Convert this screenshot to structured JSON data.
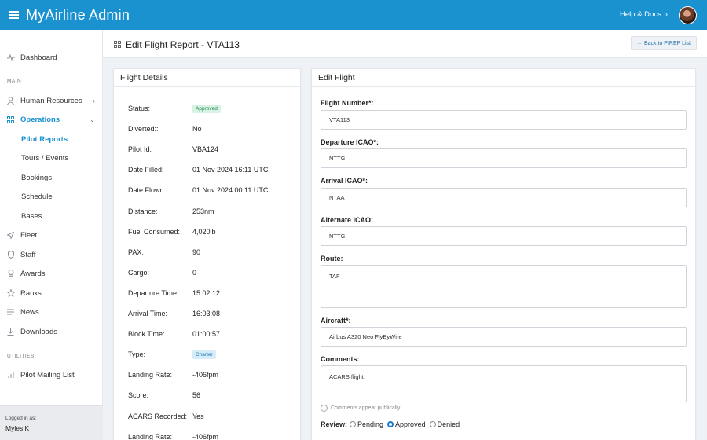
{
  "topbar": {
    "brand": "MyAirline Admin",
    "help_label": "Help & Docs",
    "help_chevron": "›",
    "accent": "#1b92d0"
  },
  "sidebar": {
    "dashboard": {
      "label": "Dashboard",
      "icon": "activity-icon"
    },
    "section_main": "MAIN",
    "section_utilities": "UTILITIES",
    "items": [
      {
        "label": "Human Resources",
        "icon": "person-icon",
        "chevron": "›"
      },
      {
        "label": "Operations",
        "icon": "grid-icon",
        "chevron": "⌄"
      },
      {
        "label": "Fleet",
        "icon": "plane-icon"
      },
      {
        "label": "Staff",
        "icon": "shield-icon"
      },
      {
        "label": "Awards",
        "icon": "award-icon"
      },
      {
        "label": "Ranks",
        "icon": "star-icon"
      },
      {
        "label": "News",
        "icon": "list-icon"
      },
      {
        "label": "Downloads",
        "icon": "download-icon"
      }
    ],
    "operations_sub": [
      {
        "label": "Pilot Reports"
      },
      {
        "label": "Tours / Events"
      },
      {
        "label": "Bookings"
      },
      {
        "label": "Schedule"
      },
      {
        "label": "Bases"
      }
    ],
    "utilities": [
      {
        "label": "Pilot Mailing List",
        "icon": "bars-icon"
      }
    ],
    "logged_in_label": "Logged in as:",
    "logged_in_user": "Myles K"
  },
  "page": {
    "title": "Edit Flight Report - VTA113",
    "back_label": "← Back to PIREP List"
  },
  "details": {
    "title": "Flight Details",
    "rows": [
      {
        "key": "Status:",
        "value": "Approved",
        "badge": "green"
      },
      {
        "key": "Diverted::",
        "value": "No"
      },
      {
        "key": "Pilot Id:",
        "value": "VBA124"
      },
      {
        "key": "Date Filled:",
        "value": "01 Nov 2024 16:11 UTC"
      },
      {
        "key": "Date Flown:",
        "value": "01 Nov 2024 00:11 UTC"
      },
      {
        "key": "Distance:",
        "value": "253nm"
      },
      {
        "key": "Fuel Consumed:",
        "value": "4,020lb"
      },
      {
        "key": "PAX:",
        "value": "90"
      },
      {
        "key": "Cargo:",
        "value": "0"
      },
      {
        "key": "Departure Time:",
        "value": "15:02:12"
      },
      {
        "key": "Arrival Time:",
        "value": "16:03:08"
      },
      {
        "key": "Block Time:",
        "value": "01:00:57"
      },
      {
        "key": "Type:",
        "value": "Charter",
        "badge": "blue"
      },
      {
        "key": "Landing Rate:",
        "value": "-406fpm"
      },
      {
        "key": "Score:",
        "value": "56"
      },
      {
        "key": "ACARS Recorded:",
        "value": "Yes"
      },
      {
        "key": "Landing Rate:",
        "value": "-406fpm"
      }
    ]
  },
  "edit": {
    "title": "Edit Flight",
    "flight_number": {
      "label": "Flight Number*:",
      "value": "VTA113"
    },
    "departure": {
      "label": "Departure ICAO*:",
      "value": "NTTG"
    },
    "arrival": {
      "label": "Arrival ICAO*:",
      "value": "NTAA"
    },
    "alternate": {
      "label": "Alternate ICAO:",
      "value": "NTTG"
    },
    "route": {
      "label": "Route:",
      "value": "TAF"
    },
    "aircraft": {
      "label": "Aircraft*:",
      "value": "Airbus A320 Neo FlyByWire"
    },
    "comments": {
      "label": "Comments:",
      "value": "ACARS flight."
    },
    "comments_hint": "Comments appear publically.",
    "review": {
      "label": "Review:",
      "options": [
        "Pending",
        "Approved",
        "Denied"
      ],
      "selected": "Approved"
    }
  }
}
